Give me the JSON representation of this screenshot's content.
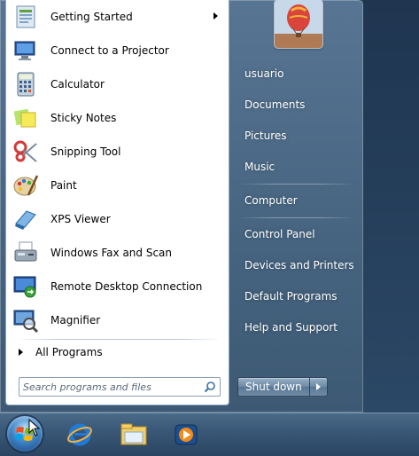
{
  "start_menu": {
    "programs": [
      {
        "label": "Getting Started",
        "icon": "getting-started-icon",
        "has_submenu": true
      },
      {
        "label": "Connect to a Projector",
        "icon": "projector-icon"
      },
      {
        "label": "Calculator",
        "icon": "calculator-icon"
      },
      {
        "label": "Sticky Notes",
        "icon": "sticky-notes-icon"
      },
      {
        "label": "Snipping Tool",
        "icon": "snipping-tool-icon"
      },
      {
        "label": "Paint",
        "icon": "paint-icon"
      },
      {
        "label": "XPS Viewer",
        "icon": "xps-viewer-icon"
      },
      {
        "label": "Windows Fax and Scan",
        "icon": "fax-scan-icon"
      },
      {
        "label": "Remote Desktop Connection",
        "icon": "remote-desktop-icon"
      },
      {
        "label": "Magnifier",
        "icon": "magnifier-icon"
      }
    ],
    "all_programs_label": "All Programs",
    "search_placeholder": "Search programs and files",
    "right_links": [
      {
        "label": "usuario"
      },
      {
        "label": "Documents"
      },
      {
        "label": "Pictures"
      },
      {
        "label": "Music"
      },
      {
        "label": "Computer"
      },
      {
        "label": "Control Panel"
      },
      {
        "label": "Devices and Printers"
      },
      {
        "label": "Default Programs"
      },
      {
        "label": "Help and Support"
      }
    ],
    "shutdown_label": "Shut down",
    "user_picture": "hot-air-balloon-picture"
  },
  "taskbar": {
    "icons": [
      "start-orb-icon",
      "internet-explorer-icon",
      "windows-explorer-icon",
      "media-player-icon"
    ]
  },
  "colors": {
    "menu_blue": "#4e6f8f",
    "taskbar": "#3a5877",
    "left_pane": "#ffffff"
  }
}
